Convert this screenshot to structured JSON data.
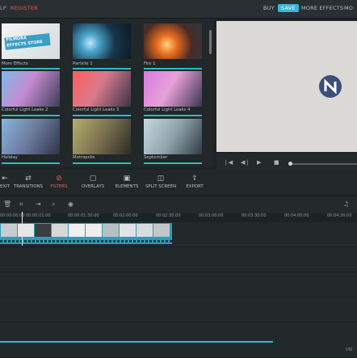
{
  "topbar": {
    "help": "LP",
    "register": "REGISTER",
    "buy": "BUY",
    "save": "SAVE",
    "more_effects": "MORE EFFECTS",
    "more_cut": "MO"
  },
  "library": {
    "tiles": [
      {
        "label": "More Effects",
        "badge_line1": "FILMORA",
        "badge_line2": "EFFECTS STORE"
      },
      {
        "label": "Particle 1"
      },
      {
        "label": "Fire 1"
      },
      {
        "label": "Colorful Light Leaks 2"
      },
      {
        "label": "Colorful Light Leaks 3"
      },
      {
        "label": "Colorful Light Leaks 4"
      },
      {
        "label": "Holiday"
      },
      {
        "label": "Metropolis"
      },
      {
        "label": "September"
      }
    ]
  },
  "toolbar": {
    "items": [
      {
        "label": "EXIT",
        "icon": "exit-icon"
      },
      {
        "label": "TRANSITIONS",
        "icon": "transitions-icon"
      },
      {
        "label": "FILTERS",
        "icon": "filters-icon",
        "active": true
      },
      {
        "label": "OVERLAYS",
        "icon": "overlays-icon"
      },
      {
        "label": "ELEMENTS",
        "icon": "elements-icon"
      },
      {
        "label": "SPLIT SCREEN",
        "icon": "split-screen-icon"
      },
      {
        "label": "EXPORT",
        "icon": "export-icon"
      }
    ]
  },
  "timeline": {
    "ticks": [
      "00:00:00:00",
      "00:00:01:00",
      "00:00:01:30:00",
      "00:02:00:00",
      "00:02:30:00",
      "00:03:00:00",
      "00:03:30:00",
      "00:04:00:00",
      "00:04:30:00"
    ],
    "bottom_right": "USI"
  },
  "colors": {
    "accent": "#3ab3d6",
    "active": "#e9644f",
    "clip": "#2b9fb0"
  }
}
